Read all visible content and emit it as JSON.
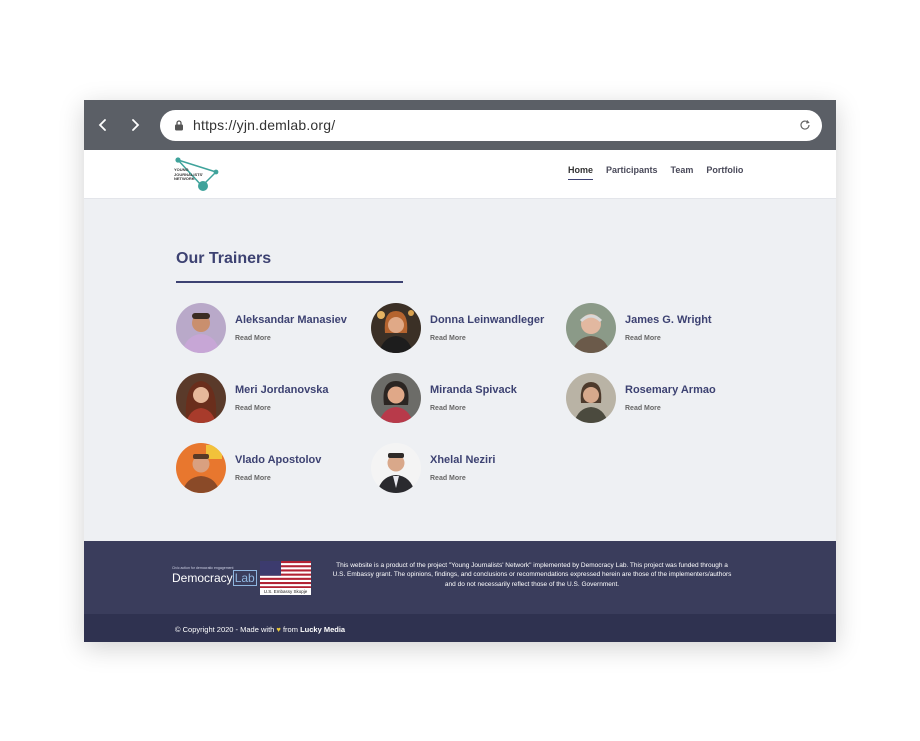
{
  "browser": {
    "url": "https://yjn.demlab.org/"
  },
  "site": {
    "logo_text": [
      "YOUNG",
      "JOURNALISTS'",
      "NETWORK"
    ],
    "nav": [
      {
        "label": "Home"
      },
      {
        "label": "Participants"
      },
      {
        "label": "Team"
      },
      {
        "label": "Portfolio"
      }
    ]
  },
  "section": {
    "title": "Our Trainers"
  },
  "trainers": [
    {
      "name": "Aleksandar Manasiev",
      "link": "Read More"
    },
    {
      "name": "Donna Leinwandleger",
      "link": "Read More"
    },
    {
      "name": "James G. Wright",
      "link": "Read More"
    },
    {
      "name": "Meri Jordanovska",
      "link": "Read More"
    },
    {
      "name": "Miranda Spivack",
      "link": "Read More"
    },
    {
      "name": "Rosemary Armao",
      "link": "Read More"
    },
    {
      "name": "Vlado Apostolov",
      "link": "Read More"
    },
    {
      "name": "Xhelal Neziri",
      "link": "Read More"
    }
  ],
  "footer": {
    "democracy_lab": {
      "tagline": "Civic action for democratic engagement",
      "word": "Democracy",
      "lab": "Lab"
    },
    "embassy_caption": "U.S. Embassy Skopje",
    "disclaimer": "This website is a product of the project \"Young Journalists' Network\" implemented by Democracy Lab. This project was funded through a U.S. Embassy grant. The opinions, findings, and conclusions or recommendations expressed herein are those of the implementers/authors and do not necessarily reflect those of the U.S. Government.",
    "copyright_prefix": "© Copyright 2020 - Made with",
    "heart": "♥",
    "copyright_from": "from",
    "maker": "Lucky Media"
  },
  "colors": {
    "accent": "#3d4272",
    "footer": "#3a3d5c",
    "copybar": "#2f3250",
    "chrome": "#5b5f66",
    "logo_teal": "#3fa39b"
  }
}
